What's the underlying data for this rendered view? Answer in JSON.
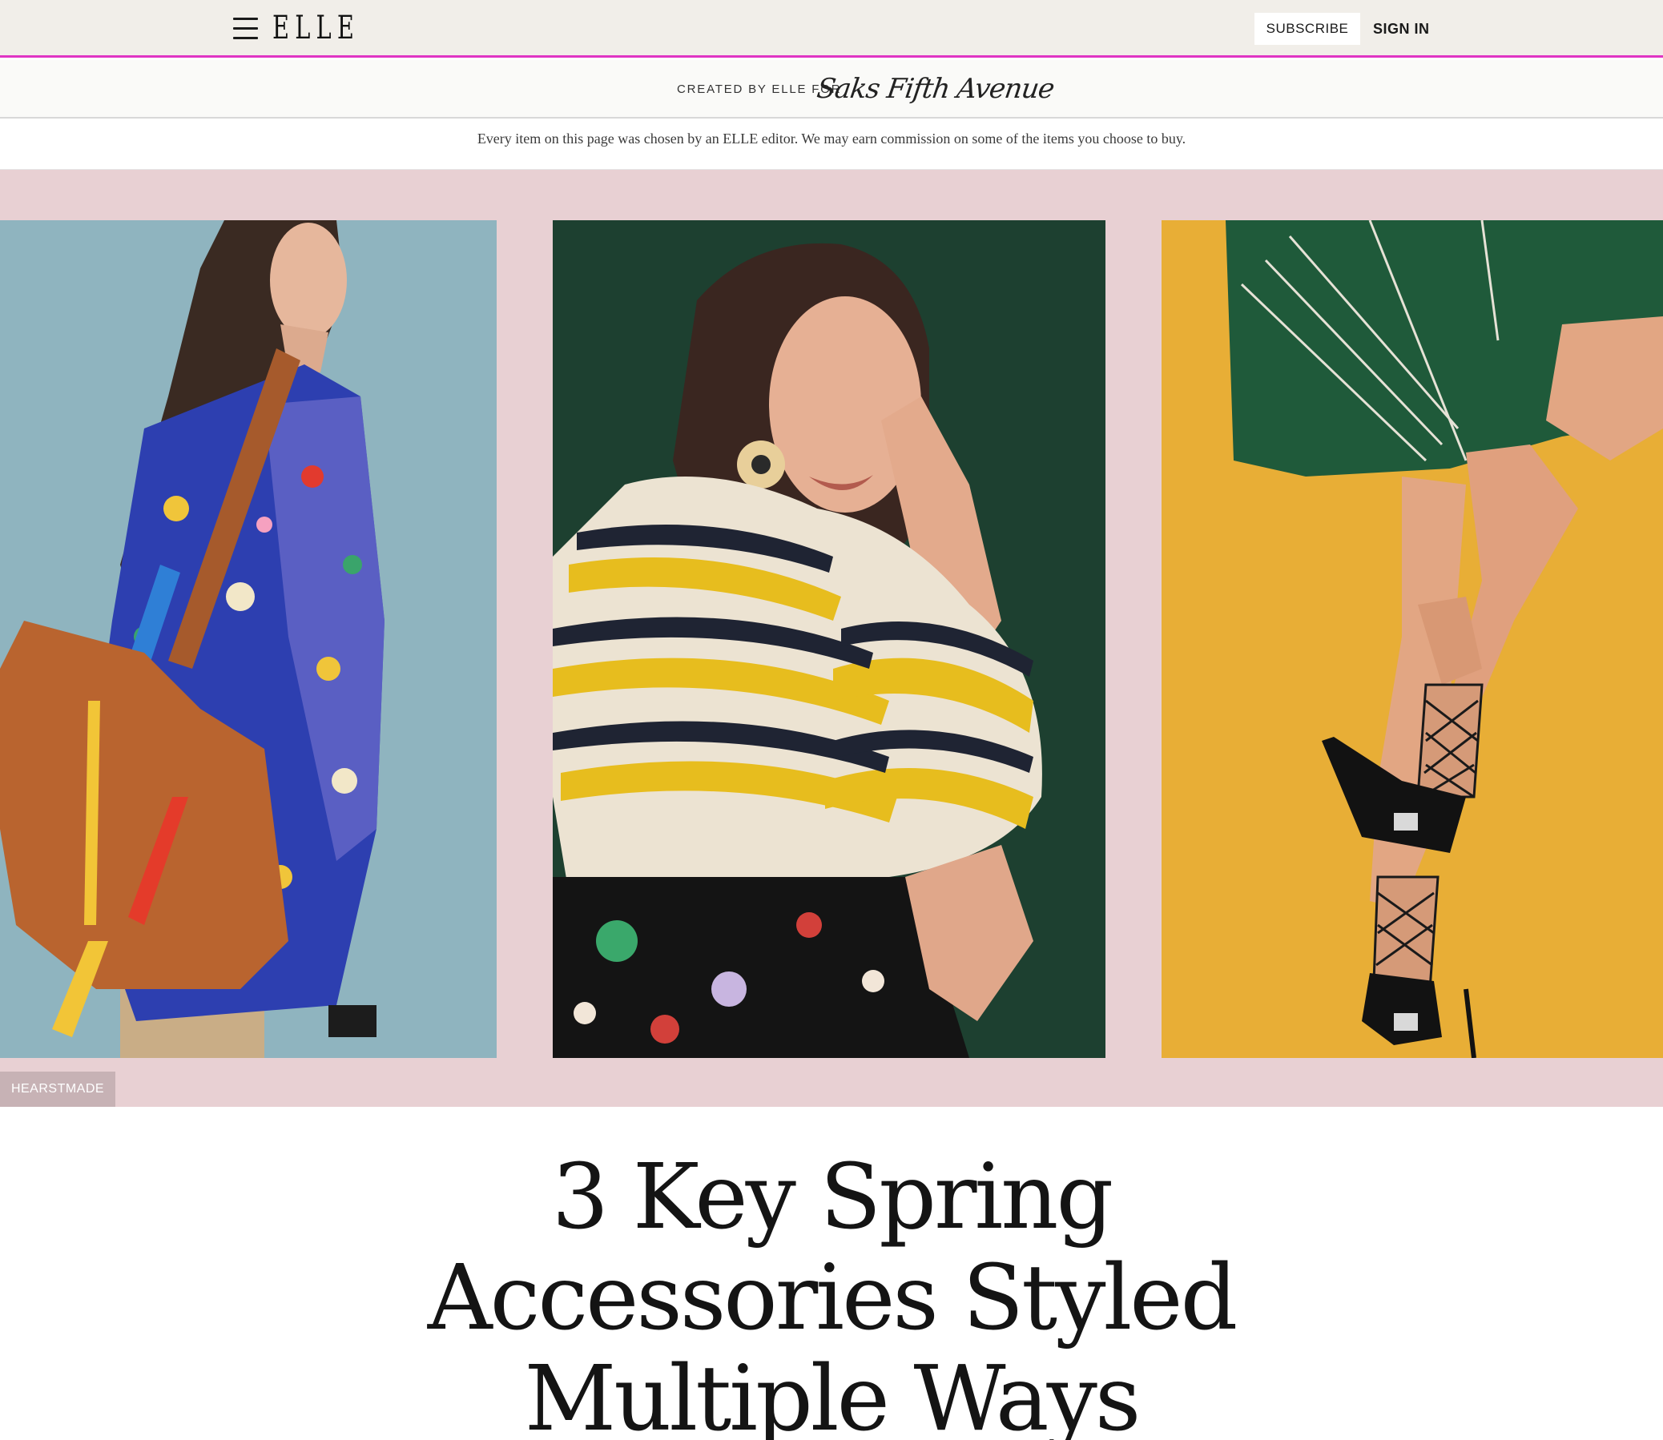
{
  "header": {
    "logo": "ELLE",
    "subscribe_label": "SUBSCRIBE",
    "signin_label": "SIGN IN",
    "accent_color": "#e035c4"
  },
  "sponsor": {
    "created_by": "CREATED BY ELLE FOR",
    "brand": "Saks Fifth Avenue"
  },
  "disclaimer": {
    "text": "Every item on this page was chosen by an ELLE editor. We may earn commission on some of the items you choose to buy."
  },
  "hero": {
    "background_color": "#e8d0d3",
    "photo_backgrounds": [
      "#8eb3be",
      "#1c3f30",
      "#e7ae35"
    ],
    "source_tag": "HEARSTMADE"
  },
  "article": {
    "title": "3 Key Spring Accessories Styled Multiple Ways"
  }
}
